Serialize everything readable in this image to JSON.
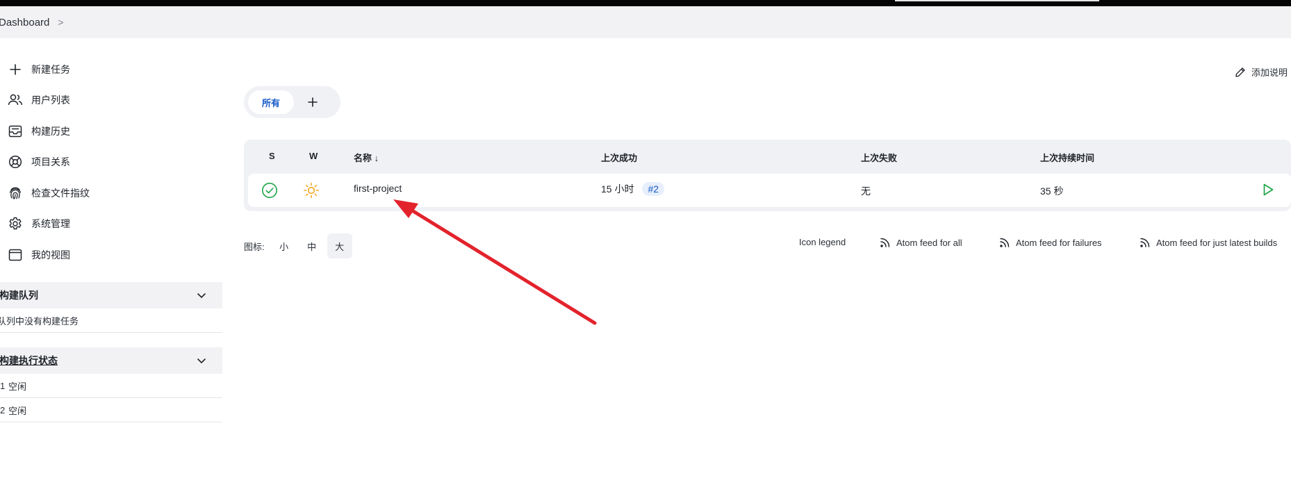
{
  "breadcrumb": {
    "root": "Dashboard",
    "separator": ">"
  },
  "sidebar": {
    "tasks": [
      {
        "label": "新建任务",
        "icon": "plus-icon"
      },
      {
        "label": "用户列表",
        "icon": "users-icon"
      },
      {
        "label": "构建历史",
        "icon": "inbox-icon"
      },
      {
        "label": "项目关系",
        "icon": "relationship-icon"
      },
      {
        "label": "检查文件指纹",
        "icon": "fingerprint-icon"
      },
      {
        "label": "系统管理",
        "icon": "gear-icon"
      },
      {
        "label": "我的视图",
        "icon": "window-icon"
      }
    ],
    "build_queue": {
      "title": "构建队列",
      "empty_message": "队列中没有构建任务"
    },
    "executor_status": {
      "title": "构建执行状态",
      "executors": [
        {
          "number": "1",
          "status": "空闲"
        },
        {
          "number": "2",
          "status": "空闲"
        }
      ]
    }
  },
  "main": {
    "add_description": "添加说明",
    "tabs": {
      "all": "所有"
    },
    "table": {
      "headers": {
        "s": "S",
        "w": "W",
        "name": "名称 ↓",
        "last_success": "上次成功",
        "last_failure": "上次失败",
        "last_duration": "上次持续时间"
      },
      "rows": [
        {
          "name": "first-project",
          "last_success": "15 小时",
          "build": "#2",
          "last_failure": "无",
          "last_duration": "35 秒"
        }
      ]
    },
    "icon_size": {
      "label": "图标:",
      "small": "小",
      "medium": "中",
      "large": "大",
      "selected": "大"
    },
    "footer_links": {
      "legend": "Icon legend",
      "feed_all": "Atom feed for all",
      "feed_failures": "Atom feed for failures",
      "feed_latest": "Atom feed for just latest builds"
    }
  },
  "colors": {
    "accent": "#1558c7",
    "success": "#1ea448",
    "weather": "#f5a623",
    "annotation_arrow": "#e3232c"
  }
}
